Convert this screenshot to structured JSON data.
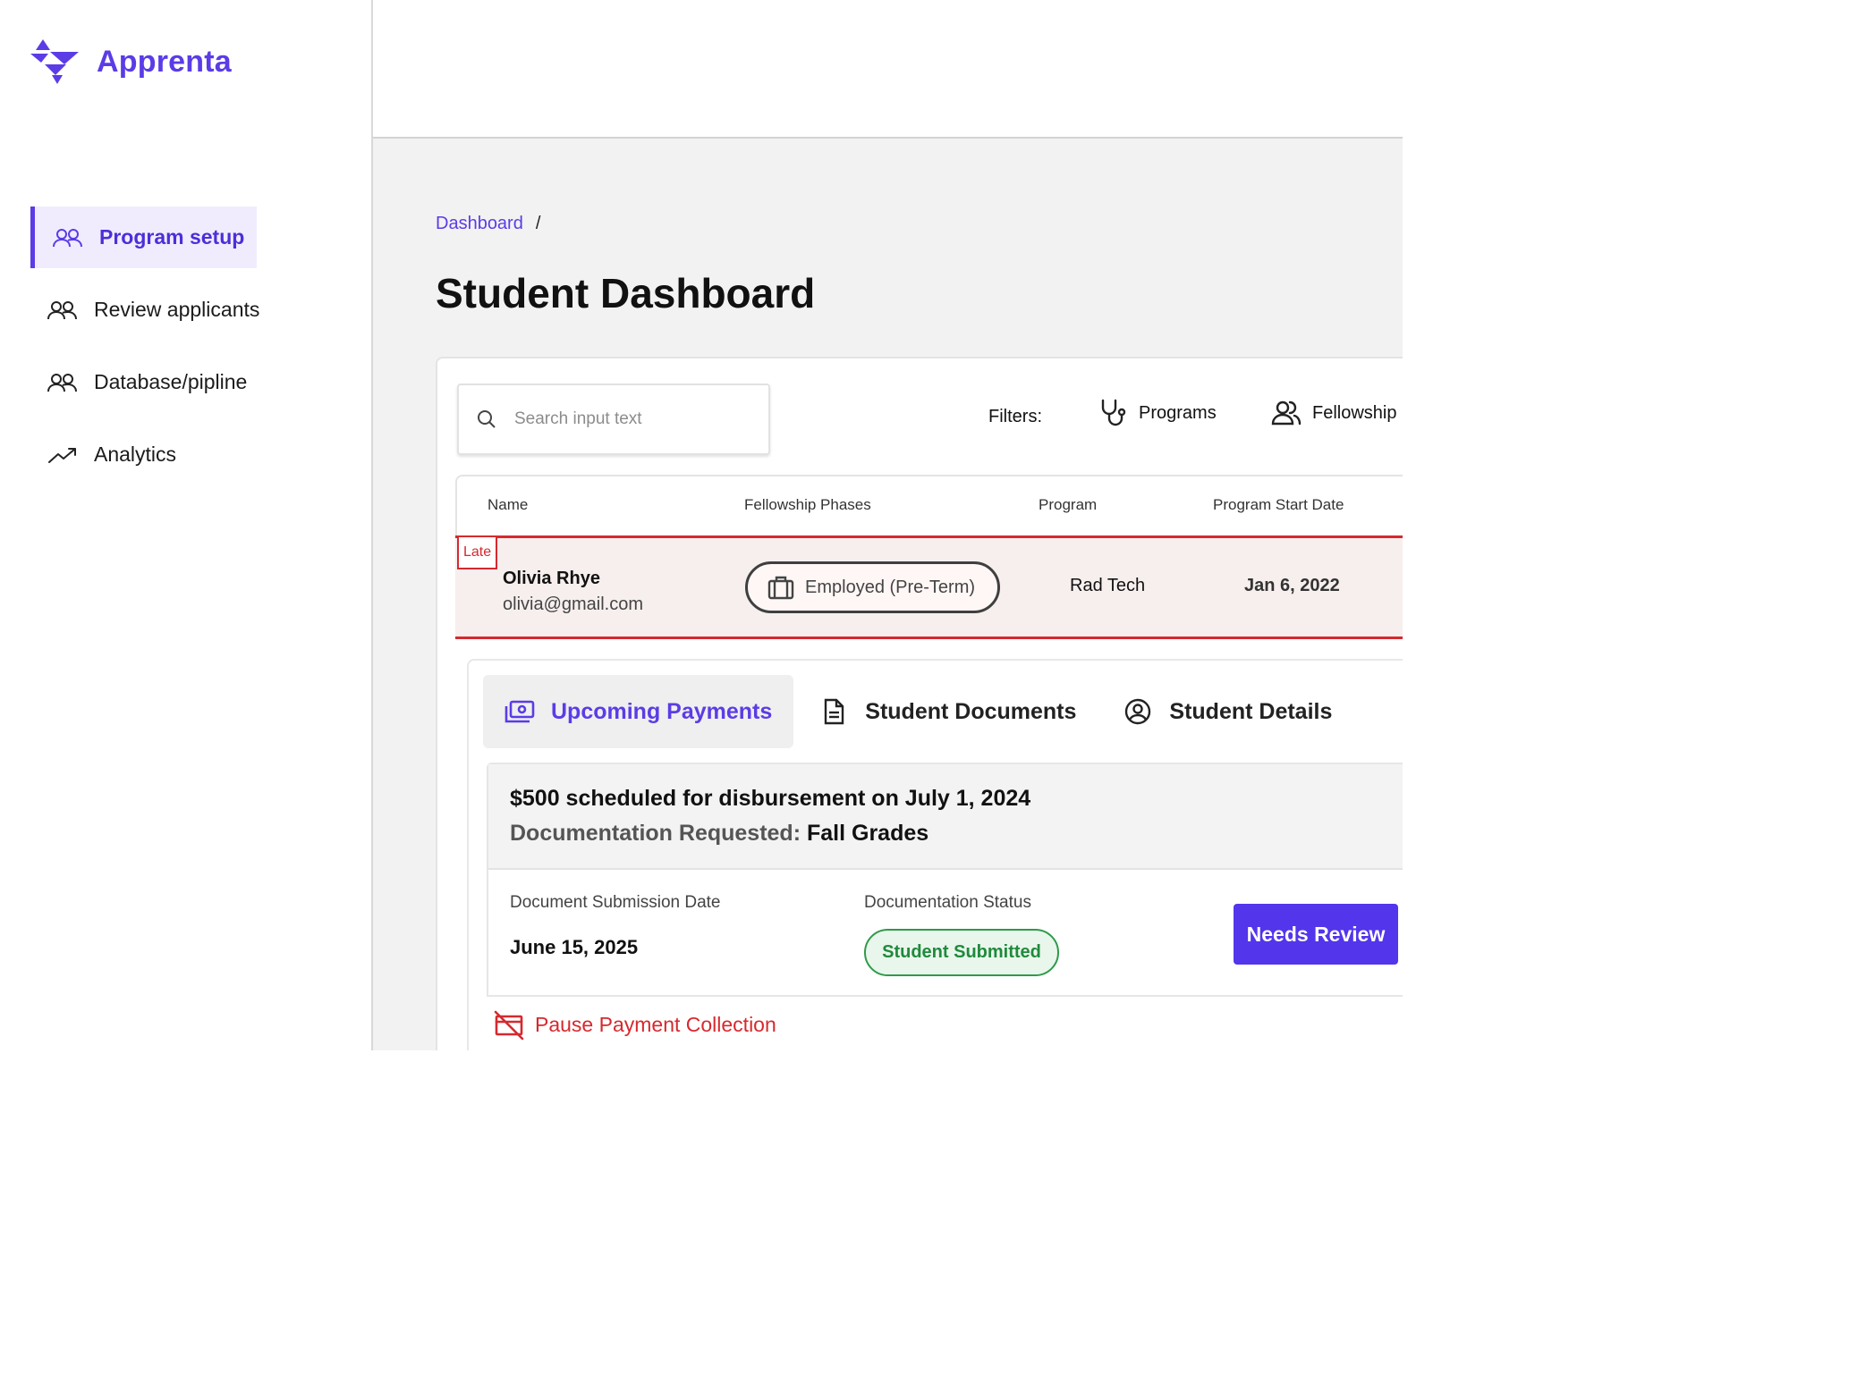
{
  "brand": {
    "name": "Apprenta",
    "color": "#5b3ce6"
  },
  "sidebar": {
    "items": [
      {
        "label": "Program setup",
        "icon": "users-icon",
        "active": true
      },
      {
        "label": "Review applicants",
        "icon": "users-icon",
        "active": false
      },
      {
        "label": "Database/pipline",
        "icon": "users-icon",
        "active": false
      },
      {
        "label": "Analytics",
        "icon": "trending-up-icon",
        "active": false
      }
    ]
  },
  "breadcrumb": {
    "link": "Dashboard",
    "separator": "/"
  },
  "page": {
    "title": "Student Dashboard"
  },
  "search": {
    "placeholder": "Search input text"
  },
  "filters": {
    "label": "Filters:",
    "items": [
      {
        "label": "Programs",
        "icon": "stethoscope-icon"
      },
      {
        "label": "Fellowship",
        "icon": "user-group-icon"
      }
    ]
  },
  "table": {
    "columns": [
      "Name",
      "Fellowship Phases",
      "Program",
      "Program Start Date"
    ],
    "row": {
      "badge": "Late",
      "name": "Olivia Rhye",
      "email": "olivia@gmail.com",
      "phase": "Employed (Pre-Term)",
      "program": "Rad Tech",
      "start_date": "Jan 6, 2022"
    }
  },
  "tabs": [
    {
      "label": "Upcoming Payments",
      "icon": "money-icon",
      "active": true
    },
    {
      "label": "Student Documents",
      "icon": "document-icon",
      "active": false
    },
    {
      "label": "Student Details",
      "icon": "user-circle-icon",
      "active": false
    }
  ],
  "payment": {
    "title": "$500 scheduled for disbursement on July 1, 2024",
    "doc_label": "Documentation Requested:",
    "doc_value": "Fall Grades",
    "submission_label": "Document Submission Date",
    "submission_date": "June 15, 2025",
    "status_label": "Documentation Status",
    "status": "Student Submitted",
    "action": "Needs Review"
  },
  "pause": {
    "label": "Pause Payment Collection",
    "color": "#d6292e"
  },
  "colors": {
    "accent": "#5b3ce6",
    "late": "#d6292e",
    "success": "#1f8a3c"
  }
}
